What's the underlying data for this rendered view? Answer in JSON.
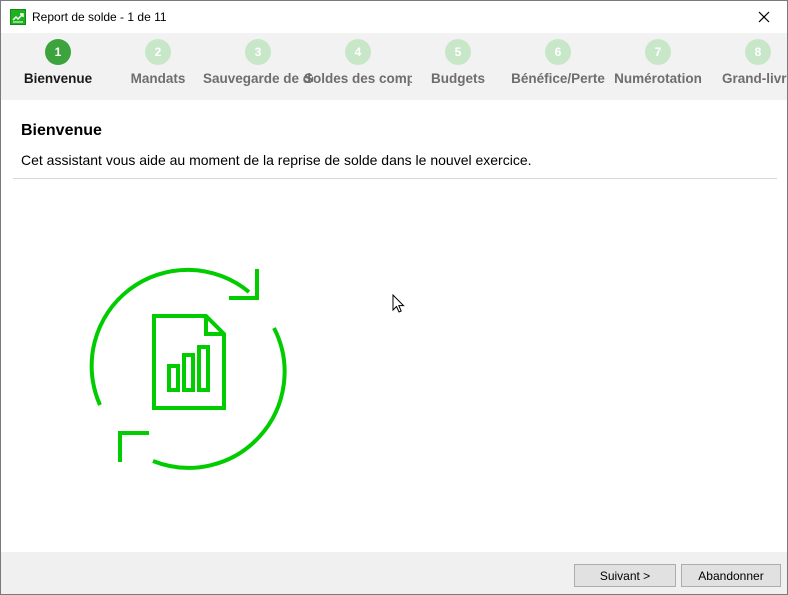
{
  "window": {
    "title": "Report de solde - 1 de 11",
    "icons": {
      "app": "chart-trend-icon",
      "close": "close-icon"
    }
  },
  "steps": [
    {
      "number": "1",
      "label": "Bienvenue",
      "active": true
    },
    {
      "number": "2",
      "label": "Mandats",
      "active": false
    },
    {
      "number": "3",
      "label": "Sauvegarde de donnée",
      "active": false
    },
    {
      "number": "4",
      "label": "Soldes des compt",
      "active": false
    },
    {
      "number": "5",
      "label": "Budgets",
      "active": false
    },
    {
      "number": "6",
      "label": "Bénéfice/Perte",
      "active": false
    },
    {
      "number": "7",
      "label": "Numérotation",
      "active": false
    },
    {
      "number": "8",
      "label": "Grand-livre",
      "active": false
    }
  ],
  "content": {
    "title": "Bienvenue",
    "description": "Cet assistant vous aide au moment de la reprise de solde dans le nouvel exercice."
  },
  "illustration": {
    "icon": "refresh-document-chart-icon",
    "color": "#00cc00"
  },
  "buttons": {
    "next": "Suivant >",
    "cancel": "Abandonner"
  },
  "colors": {
    "active_step": "#3da33d",
    "inactive_step": "#c8e7c8",
    "accent": "#00cc00"
  }
}
